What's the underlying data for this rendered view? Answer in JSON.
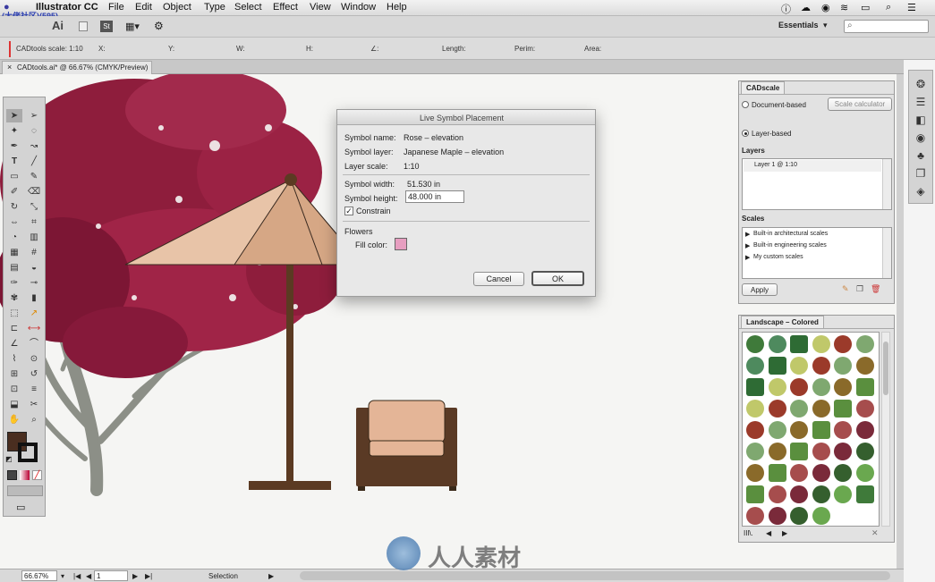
{
  "menubar": {
    "app_name": "Illustrator CC",
    "items": [
      "File",
      "Edit",
      "Object",
      "Type",
      "Select",
      "Effect",
      "View",
      "Window",
      "Help"
    ],
    "apple_icon": "apple-icon",
    "watermark_tl": "(大佬社区)(595)"
  },
  "appbar": {
    "logo": "Ai",
    "st_label": "St",
    "workspace": "Essentials",
    "workspace_arrow": "▾",
    "search_placeholder": ""
  },
  "control_bar": {
    "scale_label": "CADtools scale: 1:10",
    "x": "X:",
    "y": "Y:",
    "w": "W:",
    "h": "H:",
    "angle": "∠:",
    "length": "Length:",
    "perim": "Perim:",
    "area": "Area:"
  },
  "document_tab": {
    "title": "CADtools.ai* @ 66.67% (CMYK/Preview)",
    "close": "×"
  },
  "dialog": {
    "title": "Live Symbol Placement",
    "symbol_name_label": "Symbol name:",
    "symbol_name_value": "Rose – elevation",
    "symbol_layer_label": "Symbol layer:",
    "symbol_layer_value": "Japanese Maple – elevation",
    "layer_scale_label": "Layer scale:",
    "layer_scale_value": "1:10",
    "symbol_width_label": "Symbol width:",
    "symbol_width_value": "51.530 in",
    "symbol_height_label": "Symbol height:",
    "symbol_height_value": "48.000 in",
    "constrain_label": "Constrain",
    "constrain_checked": true,
    "flowers_label": "Flowers",
    "fill_color_label": "Fill color:",
    "fill_color": "#e79ec0",
    "cancel": "Cancel",
    "ok": "OK"
  },
  "cadscale_panel": {
    "tab": "CADscale",
    "document_based": "Document-based",
    "scale_calculator": "Scale calculator",
    "layer_based": "Layer-based",
    "layers_heading": "Layers",
    "layers": [
      "Layer 1 @ 1:10"
    ],
    "scales_heading": "Scales",
    "scales": [
      "Built-in architectural scales",
      "Built-in engineering scales",
      "My custom scales"
    ],
    "apply": "Apply"
  },
  "landscape_panel": {
    "tab": "Landscape – Colored",
    "library_icon": "IIl\\."
  },
  "status_bar": {
    "zoom": "66.67%",
    "page": "1",
    "mode": "Selection"
  },
  "watermark": "人人素材",
  "colors": {
    "maple": "#8e1d3c",
    "maple_dark": "#6d1230",
    "trunk": "#8c8f87",
    "umbrella_light": "#e8c4a8",
    "umbrella_mid": "#d6a785",
    "pole": "#5b3a22",
    "chair_frame": "#5a3a25",
    "chair_cushion": "#e4b597"
  }
}
